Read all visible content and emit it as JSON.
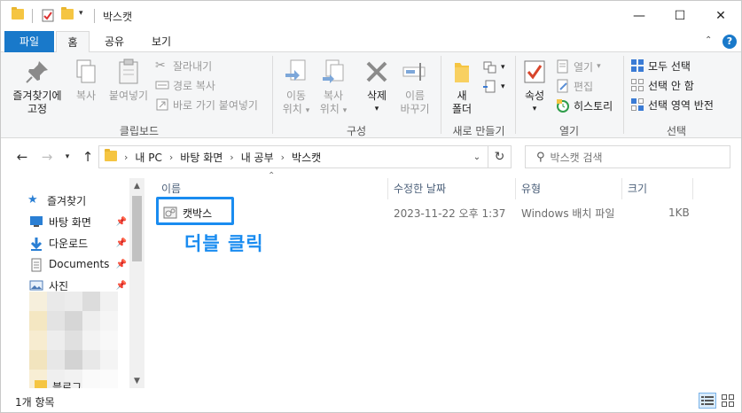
{
  "window": {
    "title": "박스캣",
    "controls": {
      "minimize": "—",
      "maximize": "☐",
      "close": "✕"
    }
  },
  "ribbon_tabs": [
    {
      "label": "파일",
      "active": false
    },
    {
      "label": "홈",
      "active": true
    },
    {
      "label": "공유",
      "active": false
    },
    {
      "label": "보기",
      "active": false
    }
  ],
  "ribbon": {
    "clipboard": {
      "pin_label_1": "즐겨찾기에",
      "pin_label_2": "고정",
      "copy": "복사",
      "paste": "붙여넣기",
      "cut": "잘라내기",
      "copy_path": "경로 복사",
      "paste_shortcut": "바로 가기 붙여넣기",
      "group": "클립보드"
    },
    "organize": {
      "move_1": "이동",
      "move_2": "위치",
      "copy_1": "복사",
      "copy_2": "위치",
      "delete": "삭제",
      "rename_1": "이름",
      "rename_2": "바꾸기",
      "group": "구성"
    },
    "new": {
      "folder_1": "새",
      "folder_2": "폴더",
      "group": "새로 만들기"
    },
    "open": {
      "properties": "속성",
      "open": "열기",
      "edit": "편집",
      "history": "히스토리",
      "group": "열기"
    },
    "select": {
      "select_all": "모두 선택",
      "select_none": "선택 안 함",
      "invert": "선택 영역 반전",
      "group": "선택"
    }
  },
  "address": {
    "crumbs": [
      "내 PC",
      "바탕 화면",
      "내 공부",
      "박스캣"
    ],
    "search_placeholder": "박스캣 검색"
  },
  "nav_pane": {
    "items": [
      {
        "label": "즐겨찾기",
        "icon": "star-icon",
        "pinned": false
      },
      {
        "label": "바탕 화면",
        "icon": "desktop-icon",
        "pinned": true
      },
      {
        "label": "다운로드",
        "icon": "download-icon",
        "pinned": true
      },
      {
        "label": "Documents",
        "icon": "document-icon",
        "pinned": true
      },
      {
        "label": "사진",
        "icon": "picture-icon",
        "pinned": true
      }
    ],
    "partial_item": "블로그"
  },
  "file_list": {
    "columns": [
      "이름",
      "수정한 날짜",
      "유형",
      "크기"
    ],
    "rows": [
      {
        "name": "캣박스",
        "modified": "2023-11-22 오후 1:37",
        "type": "Windows 배치 파일",
        "size": "1KB"
      }
    ]
  },
  "annotation": "더블 클릭",
  "status": {
    "count": "1개 항목"
  },
  "colors": {
    "accent": "#1979ca",
    "annotation": "#1a8cf0"
  }
}
